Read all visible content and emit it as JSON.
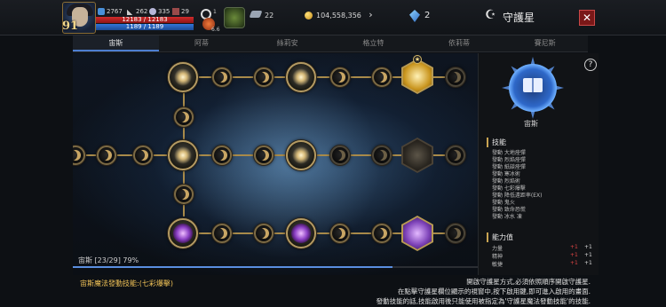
{
  "header": {
    "level": "91",
    "stats": [
      "2767",
      "262",
      "335",
      "29"
    ],
    "hp": "12183 / 12183",
    "mp": "1189 / 1189",
    "icon_small_label": "1",
    "pet_label": "6.6",
    "silver": "22",
    "gold": "104,558,356",
    "gems": "2",
    "title": "守護星"
  },
  "tabs": [
    "宙斯",
    "阿蒂",
    "絲莉安",
    "格立特",
    "依莉蒂",
    "賽尼斯"
  ],
  "progress": {
    "label": "宙斯 [23/29] 79%",
    "fraction": 0.79
  },
  "panel": {
    "emblem_name": "宙斯",
    "skills_title": "技能",
    "skills": [
      "發動 大地痊彈",
      "發動 烈焰痊彈",
      "發動 紙燄痊彈",
      "發動 寒冰術",
      "發動 烈焰術",
      "發動 七彩爆擊",
      "發動 降低遠距率(EX)",
      "發動 鬼火",
      "發動 致命恐慌",
      "發動 冰水 凍"
    ],
    "attrs_title": "能力值",
    "attrs": [
      {
        "name": "力量",
        "red": "+1",
        "white": "+1"
      },
      {
        "name": "精神",
        "red": "+1",
        "white": "+1"
      },
      {
        "name": "敏捷",
        "red": "+1",
        "white": "+1"
      }
    ]
  },
  "bottom": {
    "skill_text": "宙斯魔法發動技能:(七彩爆擊)",
    "info": [
      "開啟守護星方式,必須依照順序開啟守護星.",
      "在點擊守護星欄位顯示的視窗中,按下啟用鍵,即可進入啟用的畫面.",
      "發動技能的話,技能啟用後只能使用被指定為'守護星魔法發動技能'的技能."
    ]
  }
}
